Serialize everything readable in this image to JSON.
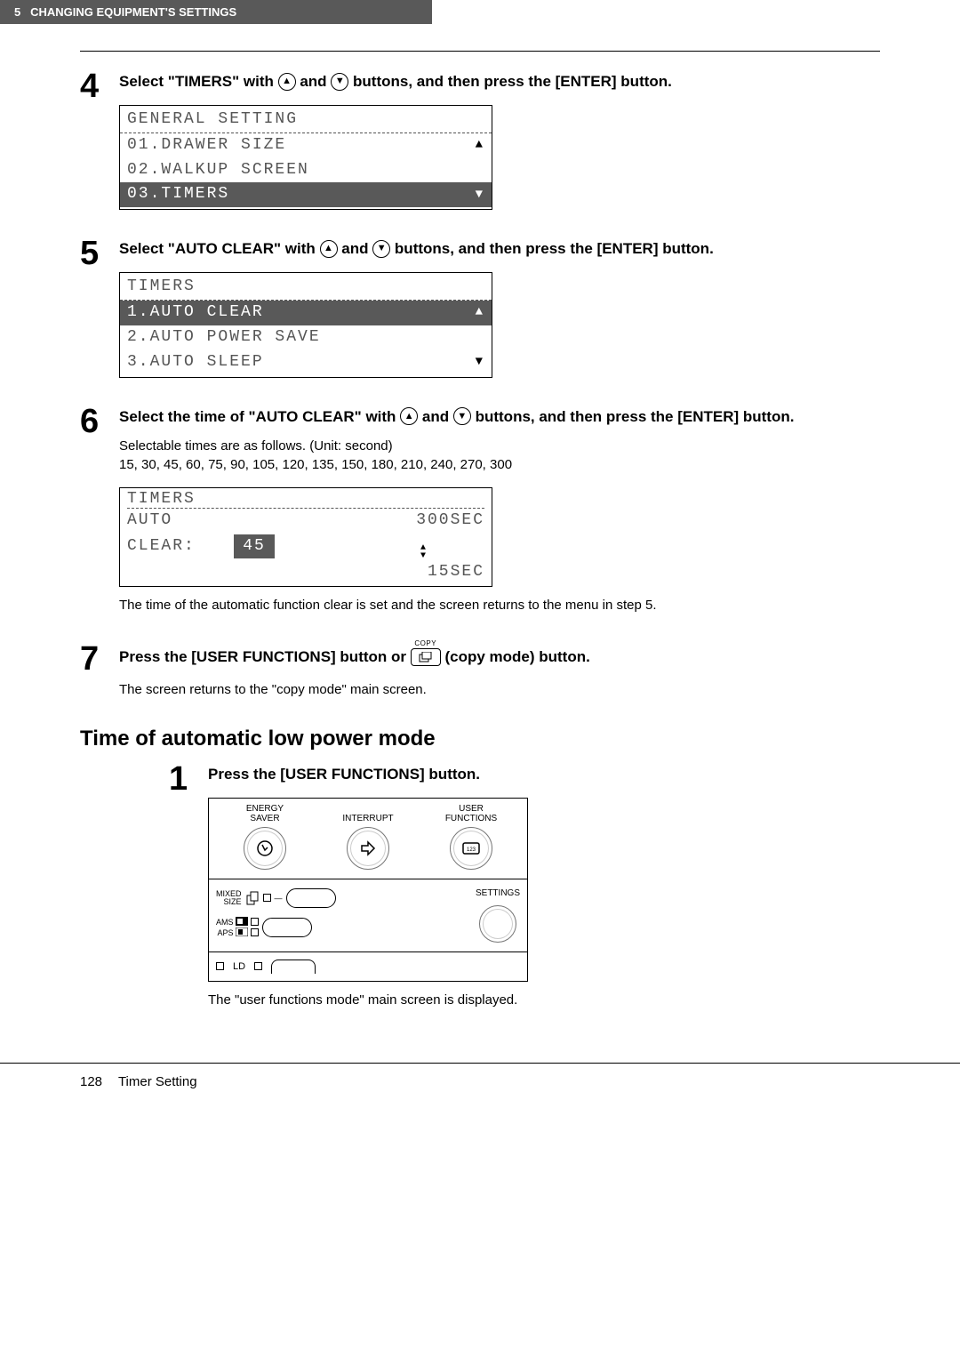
{
  "header": {
    "chapter_num": "5",
    "chapter_title": "CHANGING EQUIPMENT'S SETTINGS"
  },
  "step4": {
    "num": "4",
    "title_a": "Select \"TIMERS\" with ",
    "title_b": " and ",
    "title_c": " buttons, and then press the [ENTER] button.",
    "lcd": {
      "header": "GENERAL SETTING",
      "r1": "01.DRAWER SIZE",
      "r2": "02.WALKUP SCREEN",
      "r3": "03.TIMERS"
    }
  },
  "step5": {
    "num": "5",
    "title_a": "Select \"AUTO CLEAR\" with ",
    "title_b": " and ",
    "title_c": " buttons, and then press the [ENTER] button.",
    "lcd": {
      "header": "TIMERS",
      "r1": "1.AUTO CLEAR",
      "r2": "2.AUTO POWER SAVE",
      "r3": "3.AUTO SLEEP"
    }
  },
  "step6": {
    "num": "6",
    "title_a": "Select the time of \"AUTO CLEAR\" with ",
    "title_b": " and ",
    "title_c": " buttons, and then press the [ENTER] button.",
    "body1": "Selectable times are as follows. (Unit: second)",
    "body2": "15, 30, 45, 60, 75, 90, 105, 120, 135, 150, 180, 210, 240, 270, 300",
    "lcd": {
      "header": "TIMERS",
      "label1": "AUTO",
      "upper": "300SEC",
      "label2": " CLEAR:",
      "value": "45",
      "lower": "15SEC"
    },
    "after": "The time of the automatic function clear is set and the screen returns to the menu in step 5."
  },
  "step7": {
    "num": "7",
    "title_a": "Press the [USER FUNCTIONS] button or ",
    "title_b": " (copy mode) button.",
    "copy_label": "COPY",
    "body": "The screen returns to the \"copy mode\" main screen."
  },
  "section2": {
    "title": "Time of automatic low power mode"
  },
  "s2_step1": {
    "num": "1",
    "title": "Press the [USER FUNCTIONS] button.",
    "panel": {
      "energy": "ENERGY SAVER",
      "interrupt": "INTERRUPT",
      "userfn": "USER FUNCTIONS",
      "settings": "SETTINGS",
      "mixed": "MIXED",
      "size": "SIZE",
      "ams": "AMS",
      "aps": "APS",
      "ld": "LD"
    },
    "after": "The \"user functions mode\" main screen is displayed."
  },
  "footer": {
    "page": "128",
    "title": "Timer Setting"
  }
}
